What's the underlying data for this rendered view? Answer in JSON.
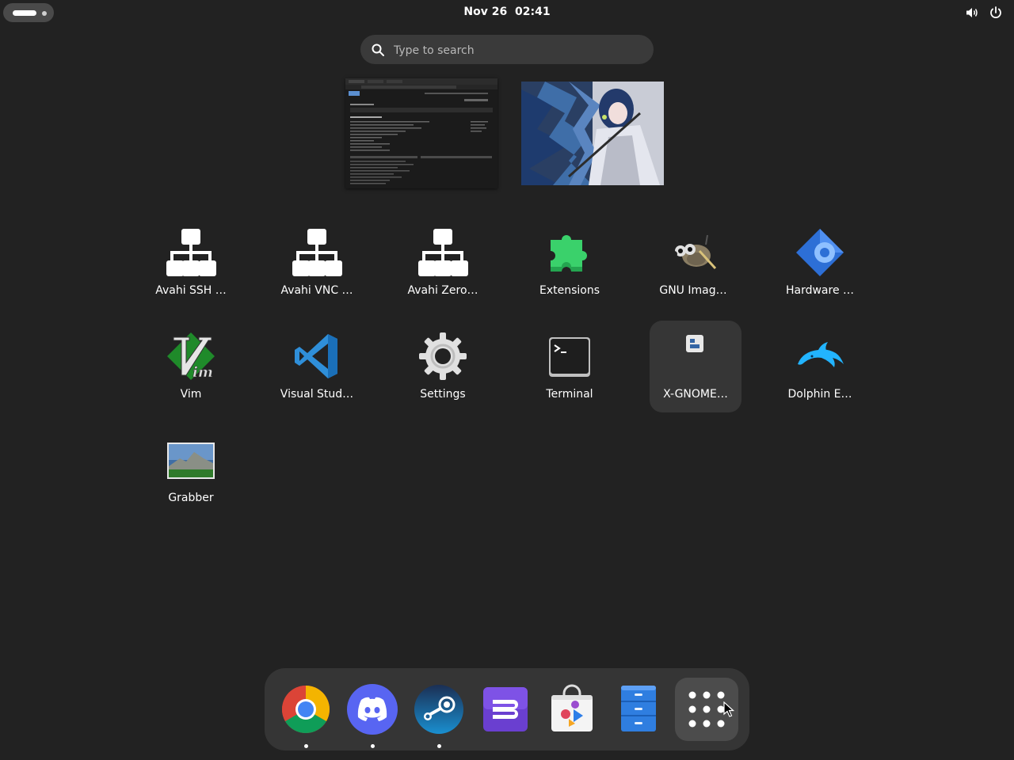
{
  "topbar": {
    "date": "Nov 26",
    "time": "02:41",
    "icons": [
      "volume-icon",
      "power-icon"
    ]
  },
  "search": {
    "placeholder": "Type to search"
  },
  "workspaces": [
    "workspace-thumbnail-browser",
    "workspace-thumbnail-wallpaper"
  ],
  "apps": [
    {
      "label": "Avahi SSH …",
      "icon": "network-icon"
    },
    {
      "label": "Avahi VNC …",
      "icon": "network-icon"
    },
    {
      "label": "Avahi Zero…",
      "icon": "network-icon"
    },
    {
      "label": "Extensions",
      "icon": "puzzle-icon"
    },
    {
      "label": "GNU Imag…",
      "icon": "gimp-icon"
    },
    {
      "label": "Hardware …",
      "icon": "hardware-gear-icon"
    },
    {
      "label": "Vim",
      "icon": "vim-icon"
    },
    {
      "label": "Visual Stud…",
      "icon": "vscode-icon"
    },
    {
      "label": "Settings",
      "icon": "gear-icon"
    },
    {
      "label": "Terminal",
      "icon": "terminal-icon"
    },
    {
      "label": "X-GNOME…",
      "icon": "generic-app-icon"
    },
    {
      "label": "Dolphin E…",
      "icon": "dolphin-icon"
    },
    {
      "label": "Grabber",
      "icon": "image-icon"
    }
  ],
  "dock": [
    {
      "name": "chrome-icon",
      "running": true
    },
    {
      "name": "discord-icon",
      "running": true
    },
    {
      "name": "steam-icon",
      "running": true
    },
    {
      "name": "boxes-icon",
      "running": false
    },
    {
      "name": "software-store-icon",
      "running": false
    },
    {
      "name": "files-cabinet-icon",
      "running": false
    },
    {
      "name": "show-apps-grid-icon",
      "running": false
    }
  ],
  "colors": {
    "background": "#222222",
    "dock": "#353535",
    "search": "#3a3a3a",
    "extensions_green": "#3ad16b",
    "vscode_blue": "#2f8fd9",
    "discord": "#5865f2"
  }
}
